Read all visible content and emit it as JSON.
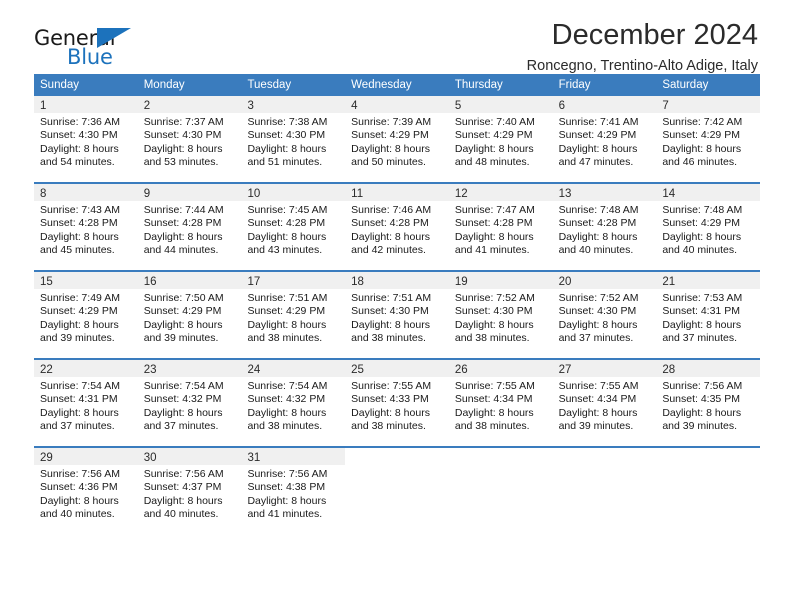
{
  "brand": {
    "name_top": "General",
    "name_bottom": "Blue",
    "accent_color": "#1c72bc",
    "triangle_icon": "triangle-icon"
  },
  "header": {
    "title": "December 2024",
    "subtitle": "Roncegno, Trentino-Alto Adige, Italy"
  },
  "calendar": {
    "header_bg": "#3a7cbe",
    "day_band_bg": "#f0f0f0",
    "weekdays": [
      "Sunday",
      "Monday",
      "Tuesday",
      "Wednesday",
      "Thursday",
      "Friday",
      "Saturday"
    ],
    "weeks": [
      [
        {
          "day": "1",
          "sunrise": "Sunrise: 7:36 AM",
          "sunset": "Sunset: 4:30 PM",
          "daylight_line1": "Daylight: 8 hours",
          "daylight_line2": "and 54 minutes."
        },
        {
          "day": "2",
          "sunrise": "Sunrise: 7:37 AM",
          "sunset": "Sunset: 4:30 PM",
          "daylight_line1": "Daylight: 8 hours",
          "daylight_line2": "and 53 minutes."
        },
        {
          "day": "3",
          "sunrise": "Sunrise: 7:38 AM",
          "sunset": "Sunset: 4:30 PM",
          "daylight_line1": "Daylight: 8 hours",
          "daylight_line2": "and 51 minutes."
        },
        {
          "day": "4",
          "sunrise": "Sunrise: 7:39 AM",
          "sunset": "Sunset: 4:29 PM",
          "daylight_line1": "Daylight: 8 hours",
          "daylight_line2": "and 50 minutes."
        },
        {
          "day": "5",
          "sunrise": "Sunrise: 7:40 AM",
          "sunset": "Sunset: 4:29 PM",
          "daylight_line1": "Daylight: 8 hours",
          "daylight_line2": "and 48 minutes."
        },
        {
          "day": "6",
          "sunrise": "Sunrise: 7:41 AM",
          "sunset": "Sunset: 4:29 PM",
          "daylight_line1": "Daylight: 8 hours",
          "daylight_line2": "and 47 minutes."
        },
        {
          "day": "7",
          "sunrise": "Sunrise: 7:42 AM",
          "sunset": "Sunset: 4:29 PM",
          "daylight_line1": "Daylight: 8 hours",
          "daylight_line2": "and 46 minutes."
        }
      ],
      [
        {
          "day": "8",
          "sunrise": "Sunrise: 7:43 AM",
          "sunset": "Sunset: 4:28 PM",
          "daylight_line1": "Daylight: 8 hours",
          "daylight_line2": "and 45 minutes."
        },
        {
          "day": "9",
          "sunrise": "Sunrise: 7:44 AM",
          "sunset": "Sunset: 4:28 PM",
          "daylight_line1": "Daylight: 8 hours",
          "daylight_line2": "and 44 minutes."
        },
        {
          "day": "10",
          "sunrise": "Sunrise: 7:45 AM",
          "sunset": "Sunset: 4:28 PM",
          "daylight_line1": "Daylight: 8 hours",
          "daylight_line2": "and 43 minutes."
        },
        {
          "day": "11",
          "sunrise": "Sunrise: 7:46 AM",
          "sunset": "Sunset: 4:28 PM",
          "daylight_line1": "Daylight: 8 hours",
          "daylight_line2": "and 42 minutes."
        },
        {
          "day": "12",
          "sunrise": "Sunrise: 7:47 AM",
          "sunset": "Sunset: 4:28 PM",
          "daylight_line1": "Daylight: 8 hours",
          "daylight_line2": "and 41 minutes."
        },
        {
          "day": "13",
          "sunrise": "Sunrise: 7:48 AM",
          "sunset": "Sunset: 4:28 PM",
          "daylight_line1": "Daylight: 8 hours",
          "daylight_line2": "and 40 minutes."
        },
        {
          "day": "14",
          "sunrise": "Sunrise: 7:48 AM",
          "sunset": "Sunset: 4:29 PM",
          "daylight_line1": "Daylight: 8 hours",
          "daylight_line2": "and 40 minutes."
        }
      ],
      [
        {
          "day": "15",
          "sunrise": "Sunrise: 7:49 AM",
          "sunset": "Sunset: 4:29 PM",
          "daylight_line1": "Daylight: 8 hours",
          "daylight_line2": "and 39 minutes."
        },
        {
          "day": "16",
          "sunrise": "Sunrise: 7:50 AM",
          "sunset": "Sunset: 4:29 PM",
          "daylight_line1": "Daylight: 8 hours",
          "daylight_line2": "and 39 minutes."
        },
        {
          "day": "17",
          "sunrise": "Sunrise: 7:51 AM",
          "sunset": "Sunset: 4:29 PM",
          "daylight_line1": "Daylight: 8 hours",
          "daylight_line2": "and 38 minutes."
        },
        {
          "day": "18",
          "sunrise": "Sunrise: 7:51 AM",
          "sunset": "Sunset: 4:30 PM",
          "daylight_line1": "Daylight: 8 hours",
          "daylight_line2": "and 38 minutes."
        },
        {
          "day": "19",
          "sunrise": "Sunrise: 7:52 AM",
          "sunset": "Sunset: 4:30 PM",
          "daylight_line1": "Daylight: 8 hours",
          "daylight_line2": "and 38 minutes."
        },
        {
          "day": "20",
          "sunrise": "Sunrise: 7:52 AM",
          "sunset": "Sunset: 4:30 PM",
          "daylight_line1": "Daylight: 8 hours",
          "daylight_line2": "and 37 minutes."
        },
        {
          "day": "21",
          "sunrise": "Sunrise: 7:53 AM",
          "sunset": "Sunset: 4:31 PM",
          "daylight_line1": "Daylight: 8 hours",
          "daylight_line2": "and 37 minutes."
        }
      ],
      [
        {
          "day": "22",
          "sunrise": "Sunrise: 7:54 AM",
          "sunset": "Sunset: 4:31 PM",
          "daylight_line1": "Daylight: 8 hours",
          "daylight_line2": "and 37 minutes."
        },
        {
          "day": "23",
          "sunrise": "Sunrise: 7:54 AM",
          "sunset": "Sunset: 4:32 PM",
          "daylight_line1": "Daylight: 8 hours",
          "daylight_line2": "and 37 minutes."
        },
        {
          "day": "24",
          "sunrise": "Sunrise: 7:54 AM",
          "sunset": "Sunset: 4:32 PM",
          "daylight_line1": "Daylight: 8 hours",
          "daylight_line2": "and 38 minutes."
        },
        {
          "day": "25",
          "sunrise": "Sunrise: 7:55 AM",
          "sunset": "Sunset: 4:33 PM",
          "daylight_line1": "Daylight: 8 hours",
          "daylight_line2": "and 38 minutes."
        },
        {
          "day": "26",
          "sunrise": "Sunrise: 7:55 AM",
          "sunset": "Sunset: 4:34 PM",
          "daylight_line1": "Daylight: 8 hours",
          "daylight_line2": "and 38 minutes."
        },
        {
          "day": "27",
          "sunrise": "Sunrise: 7:55 AM",
          "sunset": "Sunset: 4:34 PM",
          "daylight_line1": "Daylight: 8 hours",
          "daylight_line2": "and 39 minutes."
        },
        {
          "day": "28",
          "sunrise": "Sunrise: 7:56 AM",
          "sunset": "Sunset: 4:35 PM",
          "daylight_line1": "Daylight: 8 hours",
          "daylight_line2": "and 39 minutes."
        }
      ],
      [
        {
          "day": "29",
          "sunrise": "Sunrise: 7:56 AM",
          "sunset": "Sunset: 4:36 PM",
          "daylight_line1": "Daylight: 8 hours",
          "daylight_line2": "and 40 minutes."
        },
        {
          "day": "30",
          "sunrise": "Sunrise: 7:56 AM",
          "sunset": "Sunset: 4:37 PM",
          "daylight_line1": "Daylight: 8 hours",
          "daylight_line2": "and 40 minutes."
        },
        {
          "day": "31",
          "sunrise": "Sunrise: 7:56 AM",
          "sunset": "Sunset: 4:38 PM",
          "daylight_line1": "Daylight: 8 hours",
          "daylight_line2": "and 41 minutes."
        },
        {
          "day": "",
          "sunrise": "",
          "sunset": "",
          "daylight_line1": "",
          "daylight_line2": ""
        },
        {
          "day": "",
          "sunrise": "",
          "sunset": "",
          "daylight_line1": "",
          "daylight_line2": ""
        },
        {
          "day": "",
          "sunrise": "",
          "sunset": "",
          "daylight_line1": "",
          "daylight_line2": ""
        },
        {
          "day": "",
          "sunrise": "",
          "sunset": "",
          "daylight_line1": "",
          "daylight_line2": ""
        }
      ]
    ]
  }
}
